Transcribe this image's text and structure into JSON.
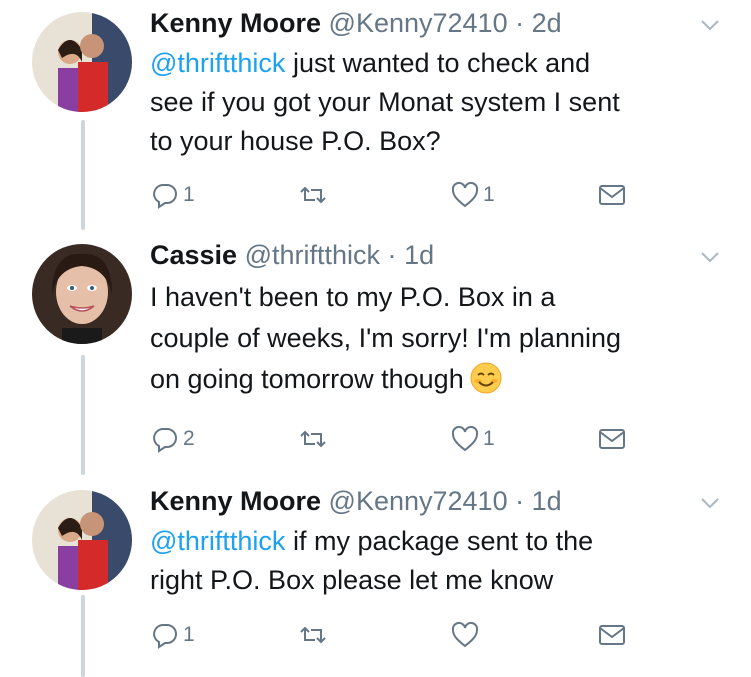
{
  "tweets": [
    {
      "name": "Kenny Moore",
      "handle": "@Kenny72410",
      "dot": "·",
      "time": "2d",
      "mention": "@thriftthick",
      "text_lines": [
        "just wanted to check and",
        "see if you got your Monat system I sent",
        "to your house P.O. Box?"
      ],
      "replies": "1",
      "retweets": "",
      "likes": "1",
      "avatar": "man-woman-photo"
    },
    {
      "name": "Cassie",
      "handle": "@thriftthick",
      "dot": "·",
      "time": "1d",
      "mention": "",
      "text_lines": [
        "I haven't been to my P.O. Box in a",
        "couple of weeks, I'm sorry! I'm planning",
        "on going tomorrow though"
      ],
      "emoji": "smiling-face-emoji",
      "replies": "2",
      "retweets": "",
      "likes": "1",
      "avatar": "woman-photo"
    },
    {
      "name": "Kenny Moore",
      "handle": "@Kenny72410",
      "dot": "·",
      "time": "1d",
      "mention": "@thriftthick",
      "text_lines": [
        "if my package sent to the",
        "right P.O. Box please let me know"
      ],
      "replies": "1",
      "retweets": "",
      "likes": "",
      "avatar": "man-woman-photo"
    }
  ],
  "colors": {
    "link": "#1da1f2",
    "secondary": "#657786",
    "thread": "#ccd6dd",
    "text": "#14171a"
  }
}
